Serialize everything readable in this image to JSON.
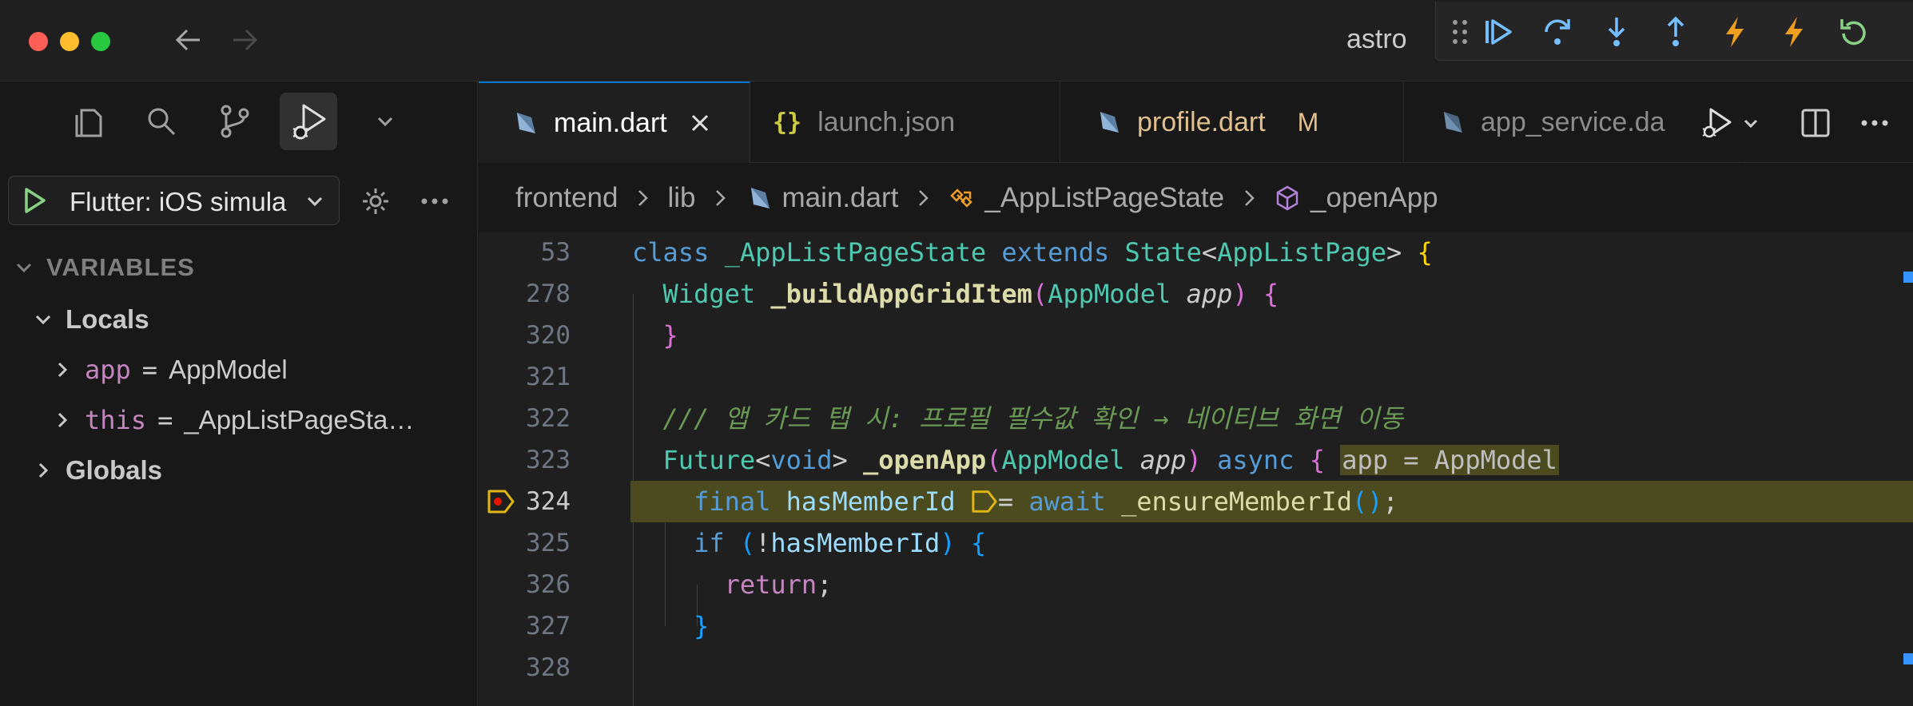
{
  "window": {
    "title": "astro"
  },
  "sidebar": {
    "launch_config": "Flutter: iOS simula",
    "variables_header": "VARIABLES",
    "locals_label": "Locals",
    "locals": [
      {
        "name": "app",
        "value": "AppModel"
      },
      {
        "name": "this",
        "value": "_AppListPageSta…"
      }
    ],
    "globals_label": "Globals"
  },
  "tabs": [
    {
      "label": "main.dart",
      "active": true
    },
    {
      "label": "launch.json",
      "active": false
    },
    {
      "label": "profile.dart",
      "active": false,
      "badge": "M"
    },
    {
      "label": "app_service.da",
      "active": false
    }
  ],
  "breadcrumb": [
    "frontend",
    "lib",
    "main.dart",
    "_AppListPageState",
    "_openApp"
  ],
  "editor": {
    "current_line": "324",
    "lines": [
      {
        "n": "53"
      },
      {
        "n": "278"
      },
      {
        "n": "320"
      },
      {
        "n": "321"
      },
      {
        "n": "322"
      },
      {
        "n": "323"
      },
      {
        "n": "324"
      },
      {
        "n": "325"
      },
      {
        "n": "326"
      },
      {
        "n": "327"
      },
      {
        "n": "328"
      }
    ],
    "code": {
      "l53": {
        "kw1": "class",
        "name": "_AppListPageState",
        "kw2": "extends",
        "type": "State",
        "lt": "<",
        "generic": "AppListPage",
        "gt": ">",
        "open": "{"
      },
      "l278": {
        "type": "Widget",
        "fn": "_buildAppGridItem",
        "paren_open": "(",
        "ptype": "AppModel",
        "param": "app",
        "paren_close": ")",
        "open": "{"
      },
      "l320": {
        "close": "}"
      },
      "l322": {
        "comment": "/// 앱 카드 탭 시: 프로필 필수값 확인 → 네이티브 화면 이동"
      },
      "l323": {
        "type": "Future",
        "lt": "<",
        "void": "void",
        "gt": ">",
        "fn": "_openApp",
        "paren_open": "(",
        "ptype": "AppModel",
        "param": "app",
        "paren_close": ")",
        "async": "async",
        "open": "{",
        "inline": "app = AppModel"
      },
      "l324": {
        "final": "final",
        "var": "hasMemberId",
        "eq": "= ",
        "await": "await",
        "fn": "_ensureMemberId",
        "call": "()",
        "semi": ";"
      },
      "l325": {
        "if": "if",
        "paren_open": "(",
        "not": "!",
        "var": "hasMemberId",
        "paren_close": ")",
        "open": "{"
      },
      "l326": {
        "ret": "return",
        "semi": ";"
      },
      "l327": {
        "close": "}"
      }
    }
  },
  "colors": {
    "accent": "#0078d4",
    "execution_highlight": "#4b4b1f",
    "breakpoint": "#e2b714",
    "modified": "#e2c08d"
  },
  "icons": {
    "debug_toolbar": [
      "drag-handle-icon",
      "continue-icon",
      "step-over-icon",
      "step-into-icon",
      "step-out-icon",
      "hot-reload-icon",
      "hot-restart-icon",
      "restart-icon"
    ],
    "activity": [
      "explorer-icon",
      "search-icon",
      "source-control-icon",
      "run-debug-icon",
      "chevron-down-icon"
    ]
  }
}
